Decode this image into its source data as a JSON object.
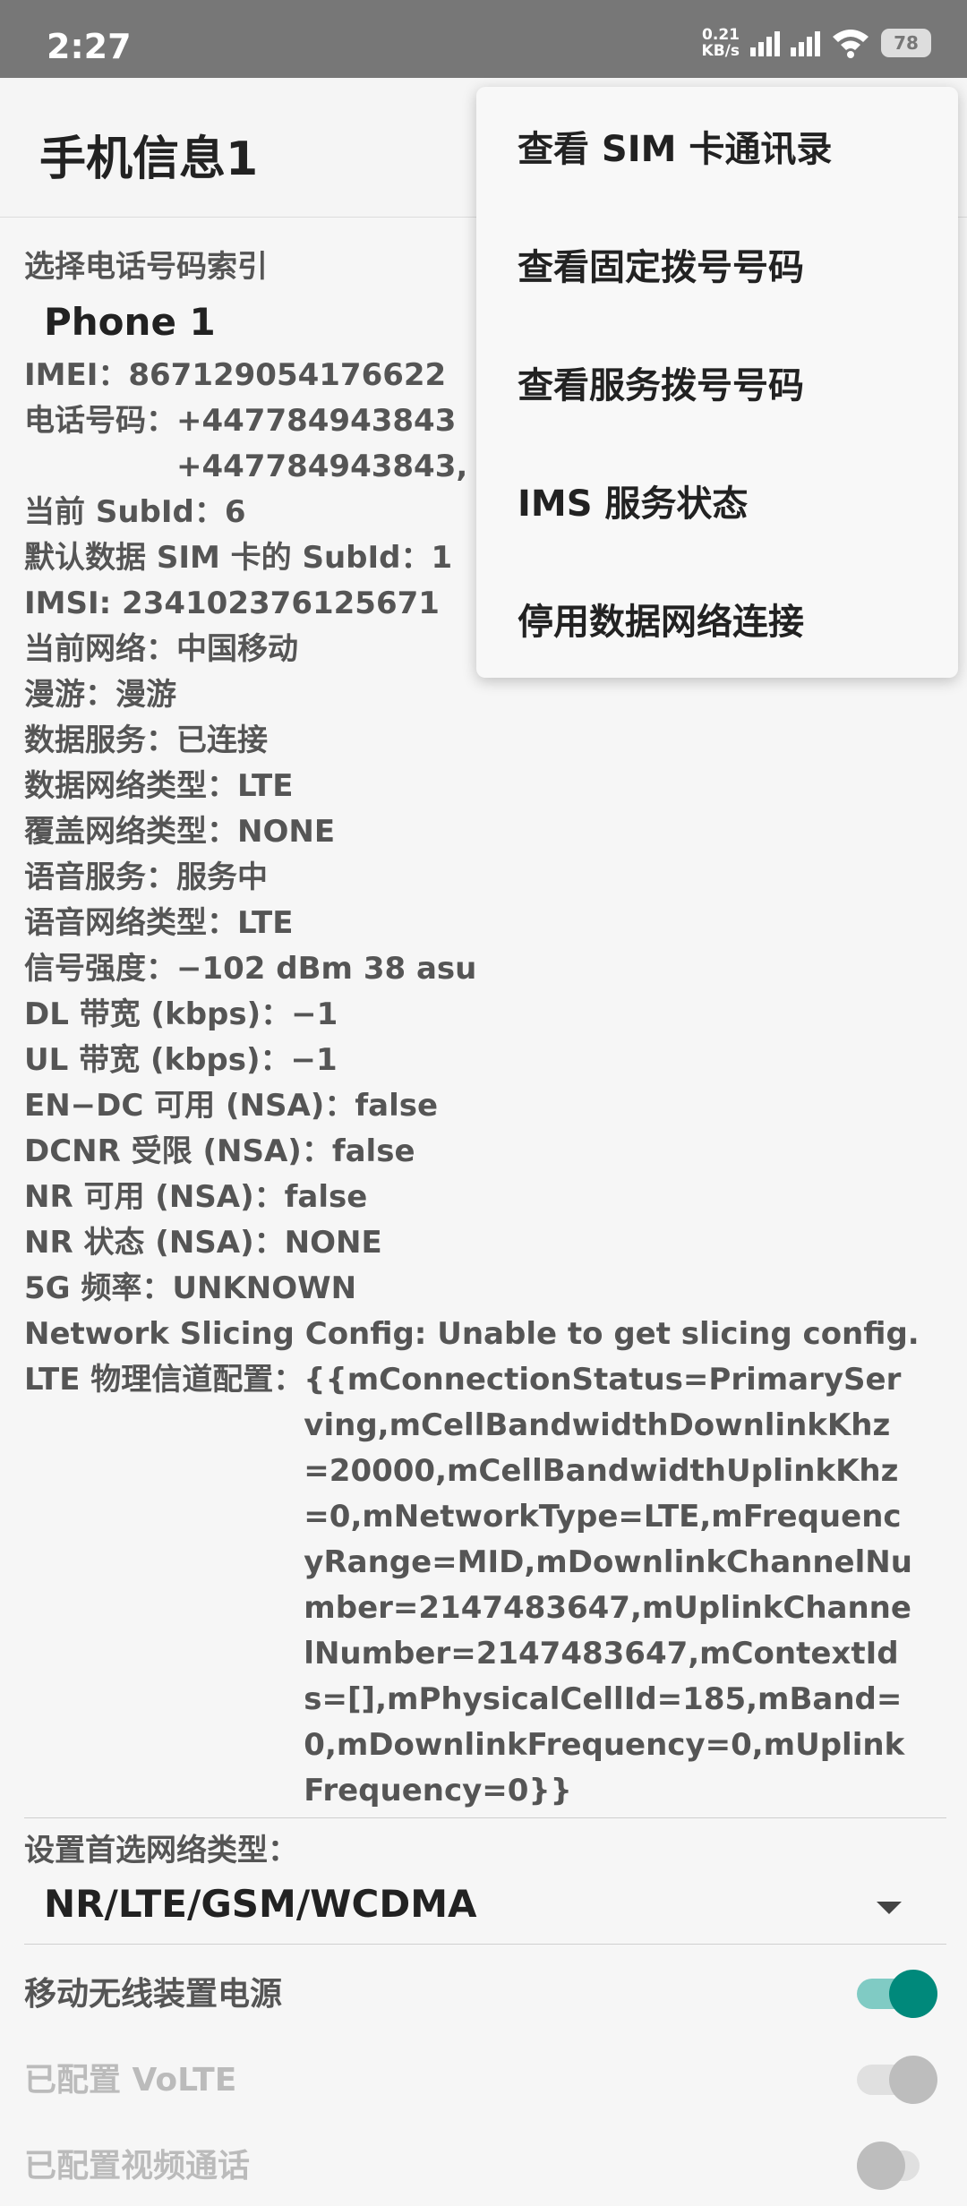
{
  "status_bar": {
    "time": "2:27",
    "net_speed_value": "0.21",
    "net_speed_unit": "KB/s",
    "battery": "78"
  },
  "app_bar": {
    "title": "手机信息1"
  },
  "phone_index": {
    "label": "选择电话号码索引",
    "value": "Phone 1"
  },
  "info": {
    "imei": "IMEI：867129054176622",
    "phone_label": "电话号码：",
    "phone_1": "+447784943843",
    "phone_2": "+447784943843,",
    "current_subid": "当前 SubId：6",
    "default_data_subid": "默认数据 SIM 卡的 SubId：1",
    "imsi": "IMSI: 234102376125671",
    "current_network": "当前网络：中国移动",
    "roaming": "漫游：漫游",
    "data_service": "数据服务：已连接",
    "data_network_type": "数据网络类型：LTE",
    "override_network_type": "覆盖网络类型：NONE",
    "voice_service": "语音服务：服务中",
    "voice_network_type": "语音网络类型：LTE",
    "signal_strength": "信号强度：−102 dBm   38 asu",
    "dl_bandwidth": "DL 带宽 (kbps)：−1",
    "ul_bandwidth": "UL 带宽 (kbps)：−1",
    "endc_available": "EN−DC 可用 (NSA)：false",
    "dcnr_restricted": "DCNR 受限 (NSA)：false",
    "nr_available": "NR 可用 (NSA)：false",
    "nr_state": "NR 状态 (NSA)：NONE",
    "frequency_5g": "5G 频率：UNKNOWN",
    "network_slicing": "Network Slicing Config: Unable to get slicing config.",
    "lte_config_label": "LTE 物理信道配置：",
    "lte_config_value": "{{mConnectionStatus=PrimaryServing,mCellBandwidthDownlinkKhz=20000,mCellBandwidthUplinkKhz=0,mNetworkType=LTE,mFrequencyRange=MID,mDownlinkChannelNumber=2147483647,mUplinkChannelNumber=2147483647,mContextIds=[],mPhysicalCellId=185,mBand=0,mDownlinkFrequency=0,mUplinkFrequency=0}}"
  },
  "preferred_network": {
    "label": "设置首选网络类型：",
    "value": "NR/LTE/GSM/WCDMA"
  },
  "toggles": [
    {
      "label": "移动无线装置电源",
      "state": "on",
      "enabled": true
    },
    {
      "label": "已配置 VoLTE",
      "state": "on",
      "enabled": false
    },
    {
      "label": "已配置视频通话",
      "state": "off",
      "enabled": false
    }
  ],
  "menu": {
    "items": [
      "查看 SIM 卡通讯录",
      "查看固定拨号号码",
      "查看服务拨号号码",
      "IMS 服务状态",
      "停用数据网络连接"
    ]
  },
  "colors": {
    "accent": "#00897b",
    "accent_track": "#80cbc4",
    "disabled_thumb": "#bdbdbd",
    "disabled_track": "#e0e0e0",
    "status_bar": "#777777"
  }
}
